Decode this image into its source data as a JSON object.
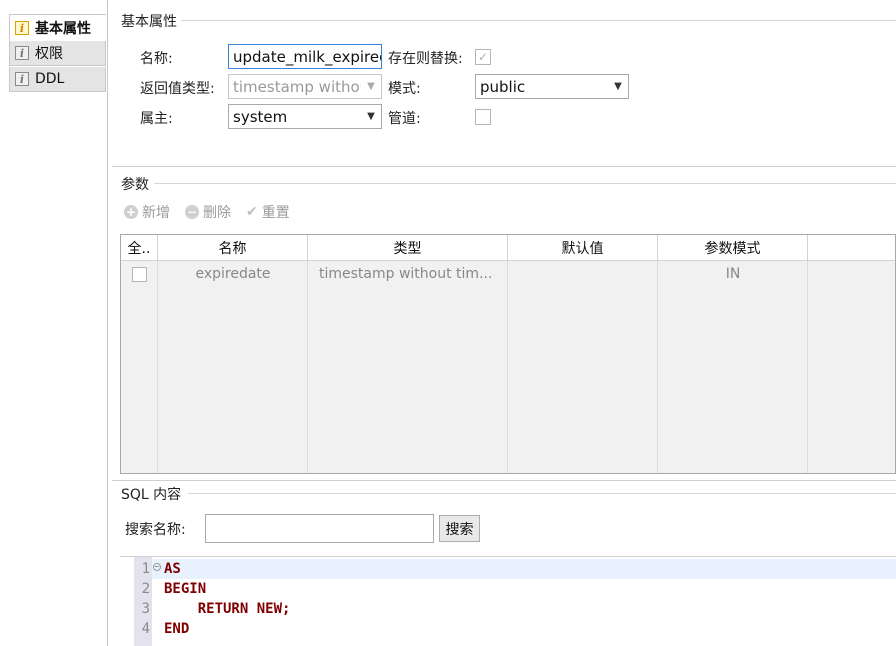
{
  "sidebar": {
    "tabs": [
      {
        "label": "基本属性",
        "icon": "info-icon",
        "active": true
      },
      {
        "label": "权限",
        "icon": "info-icon",
        "active": false
      },
      {
        "label": "DDL",
        "icon": "info-icon",
        "active": false
      }
    ]
  },
  "basic": {
    "section_title": "基本属性",
    "name_label": "名称:",
    "name_value": "update_milk_expiredate",
    "replace_label": "存在则替换:",
    "replace_checked": true,
    "return_type_label": "返回值类型:",
    "return_type_value": "timestamp without time zone",
    "schema_label": "模式:",
    "schema_value": "public",
    "owner_label": "属主:",
    "owner_value": "system",
    "pipeline_label": "管道:",
    "pipeline_checked": false
  },
  "params": {
    "section_title": "参数",
    "toolbar": {
      "add": "新增",
      "delete": "删除",
      "reset": "重置"
    },
    "columns": [
      "全..",
      "名称",
      "类型",
      "默认值",
      "参数模式"
    ],
    "rows": [
      {
        "checked": false,
        "name": "expiredate",
        "type": "timestamp without tim...",
        "default": "",
        "mode": "IN"
      }
    ]
  },
  "sql": {
    "section_title": "SQL 内容",
    "search_label": "搜索名称:",
    "search_placeholder": "",
    "search_button": "搜索",
    "lines": [
      {
        "num": "1",
        "text": "AS"
      },
      {
        "num": "2",
        "text": "BEGIN"
      },
      {
        "num": "3",
        "text": "    RETURN NEW;"
      },
      {
        "num": "4",
        "text": "END"
      }
    ]
  },
  "colors": {
    "keyword": "#7f0000",
    "focus_border": "#3b7fd6",
    "gutter": "#e3e3ef"
  }
}
